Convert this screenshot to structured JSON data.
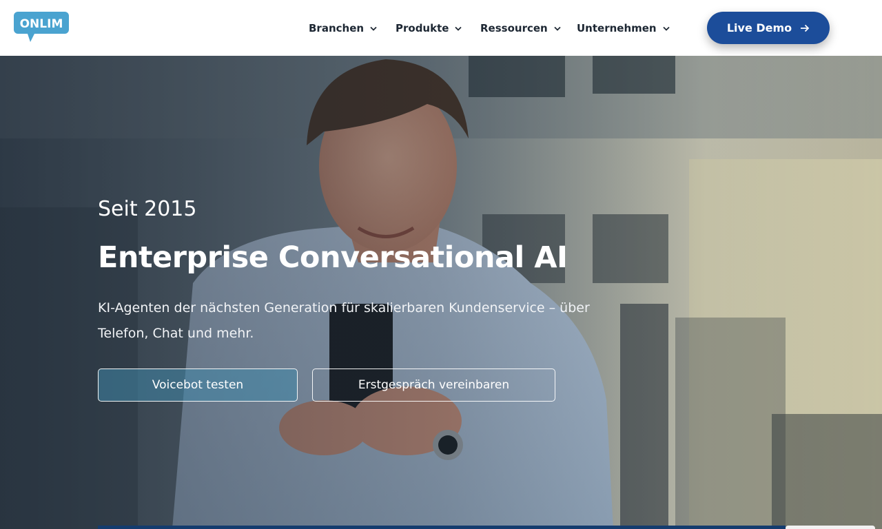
{
  "brand": {
    "logo_text": "ONLIM",
    "logo_color": "#4aa3d0"
  },
  "nav": {
    "items": [
      {
        "label": "Branchen"
      },
      {
        "label": "Produkte"
      },
      {
        "label": "Ressourcen"
      },
      {
        "label": "Unternehmen"
      }
    ],
    "cta_label": "Live Demo",
    "cta_color": "#1c4d9a"
  },
  "hero": {
    "eyebrow": "Seit 2015",
    "headline": "Enterprise Conversational AI",
    "subline": "KI-Agenten der nächsten Generation für skalierbaren Kundenservice – über Telefon, Chat und mehr.",
    "primary_button": "Voicebot testen",
    "secondary_button": "Erstgespräch vereinbaren"
  }
}
